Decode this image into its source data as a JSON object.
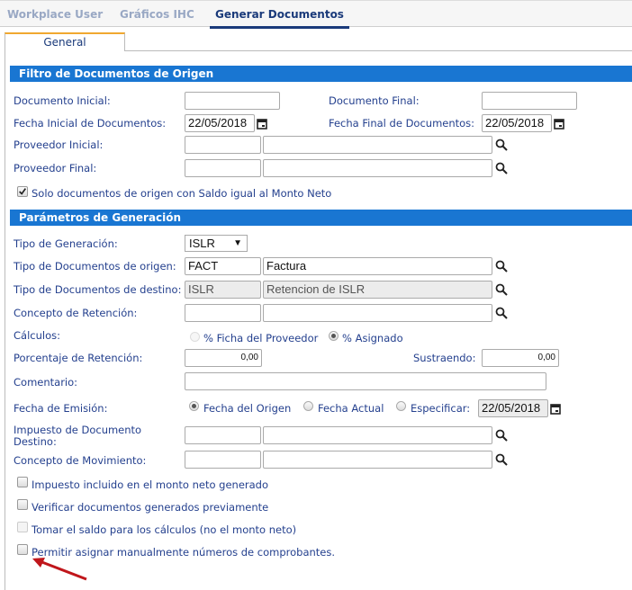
{
  "top_tabs": [
    "Workplace User",
    "Gráficos IHC",
    "Generar Documentos"
  ],
  "sub_tab": "General",
  "filtro": {
    "title": "Filtro de Documentos de Origen",
    "doc_inicial": "Documento Inicial:",
    "doc_final": "Documento Final:",
    "fecha_inicial": "Fecha Inicial de Documentos:",
    "fecha_inicial_value": "22/05/2018",
    "fecha_final": "Fecha Final de Documentos:",
    "fecha_final_value": "22/05/2018",
    "prov_inicial": "Proveedor Inicial:",
    "prov_final": "Proveedor Final:",
    "solo_saldo": "Solo documentos de origen con Saldo igual al Monto Neto"
  },
  "params": {
    "title": "Parámetros de Generación",
    "tipo_gen": "Tipo de Generación:",
    "tipo_gen_value": "ISLR",
    "tipo_origen": "Tipo de Documentos de origen:",
    "tipo_origen_code": "FACT",
    "tipo_origen_desc": "Factura",
    "tipo_destino": "Tipo de Documentos de destino:",
    "tipo_destino_code": "ISLR",
    "tipo_destino_desc": "Retencion de ISLR",
    "concepto_ret": "Concepto de Retención:",
    "calculos": "Cálculos:",
    "calc_opt1": "% Ficha del Proveedor",
    "calc_opt2": "% Asignado",
    "porcentaje": "Porcentaje de Retención:",
    "porcentaje_value": "0,00",
    "sustraendo": "Sustraendo:",
    "sustraendo_value": "0,00",
    "comentario": "Comentario:",
    "fecha_emision": "Fecha de Emisión:",
    "fe_opt1": "Fecha del Origen",
    "fe_opt2": "Fecha Actual",
    "fe_opt3": "Especificar:",
    "fe_value": "22/05/2018",
    "impuesto_dest_1": "Impuesto de Documento",
    "impuesto_dest_2": "Destino:",
    "concepto_mov": "Concepto de Movimiento:",
    "chk1": "Impuesto incluido en el monto neto generado",
    "chk2": "Verificar documentos generados previamente",
    "chk3": "Tomar el saldo para los cálculos (no el monto neto)",
    "chk4": "Permitir asignar manualmente números de comprobantes."
  }
}
